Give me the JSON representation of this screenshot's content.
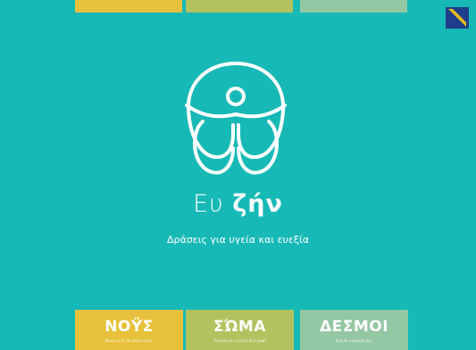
{
  "brand": {
    "word1": "Ευ",
    "word2": "ζήν",
    "tagline": "Δράσεις για υγεία και ευεξία"
  },
  "colors": {
    "background": "#17b9b6",
    "nous": "#e7c13b",
    "soma": "#b4c15f",
    "desmoi": "#94c7a3",
    "corner_logo": "#1f3d8a",
    "corner_stripes": "#f2c21a"
  },
  "icons": {
    "main_logo": "figure-with-butterfly-wings-logo",
    "corner": "striped-corner-logo"
  },
  "cards": [
    {
      "title": "ΝΟΫΣ",
      "subtitle": "Νους υγιής σε σώμα υγιές"
    },
    {
      "title": "ΣΏΜΑ",
      "subtitle": "Άσκηση και υγιεινή διατροφή"
    },
    {
      "title": "ΔΕΣΜΟΙ",
      "subtitle": "Δεσμοί ανάμεσα μας"
    }
  ]
}
